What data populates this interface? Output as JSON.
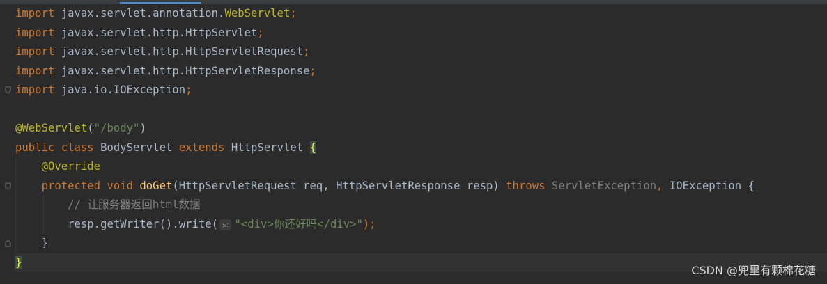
{
  "colors": {
    "background": "#2b2b2b",
    "keyword": "#cc7832",
    "annotation": "#bbb529",
    "string": "#6a8759",
    "comment": "#808080",
    "method": "#ffc66d",
    "text": "#a9b7c6",
    "tab_indicator": "#4a88c7"
  },
  "icons": [
    "fold-open-icon",
    "fold-close-icon"
  ],
  "code": {
    "imports": [
      {
        "keyword": "import",
        "path": "javax.servlet.annotation.",
        "highlight": "WebServlet",
        "end": ";"
      },
      {
        "keyword": "import",
        "path": "javax.servlet.http.HttpServlet",
        "highlight": "",
        "end": ";"
      },
      {
        "keyword": "import",
        "path": "javax.servlet.http.HttpServletRequest",
        "highlight": "",
        "end": ";"
      },
      {
        "keyword": "import",
        "path": "javax.servlet.http.HttpServletResponse",
        "highlight": "",
        "end": ";"
      },
      {
        "keyword": "import",
        "path": "java.io.IOException",
        "highlight": "",
        "end": ";"
      }
    ],
    "annotation": {
      "name": "@WebServlet",
      "open": "(",
      "value": "\"/body\"",
      "close": ")"
    },
    "class_decl": {
      "kw_public": "public",
      "kw_class": "class",
      "name": "BodyServlet",
      "kw_extends": "extends",
      "parent": "HttpServlet",
      "brace": "{"
    },
    "override": "@Override",
    "method_decl": {
      "kw_protected": "protected",
      "kw_void": "void",
      "name": "doGet",
      "params": "(HttpServletRequest req, HttpServletResponse resp)",
      "kw_throws": "throws",
      "exc1": "ServletException",
      "comma": ",",
      "exc2": "IOException",
      "brace": "{"
    },
    "comment": "// 让服务器返回html数据",
    "statement": {
      "call": "resp.getWriter().write(",
      "hint": "s:",
      "arg": "\"<div>你还好吗</div>\"",
      "end": ");"
    },
    "method_close": "}",
    "class_close": "}"
  },
  "watermark": "CSDN @兜里有颗棉花糖"
}
